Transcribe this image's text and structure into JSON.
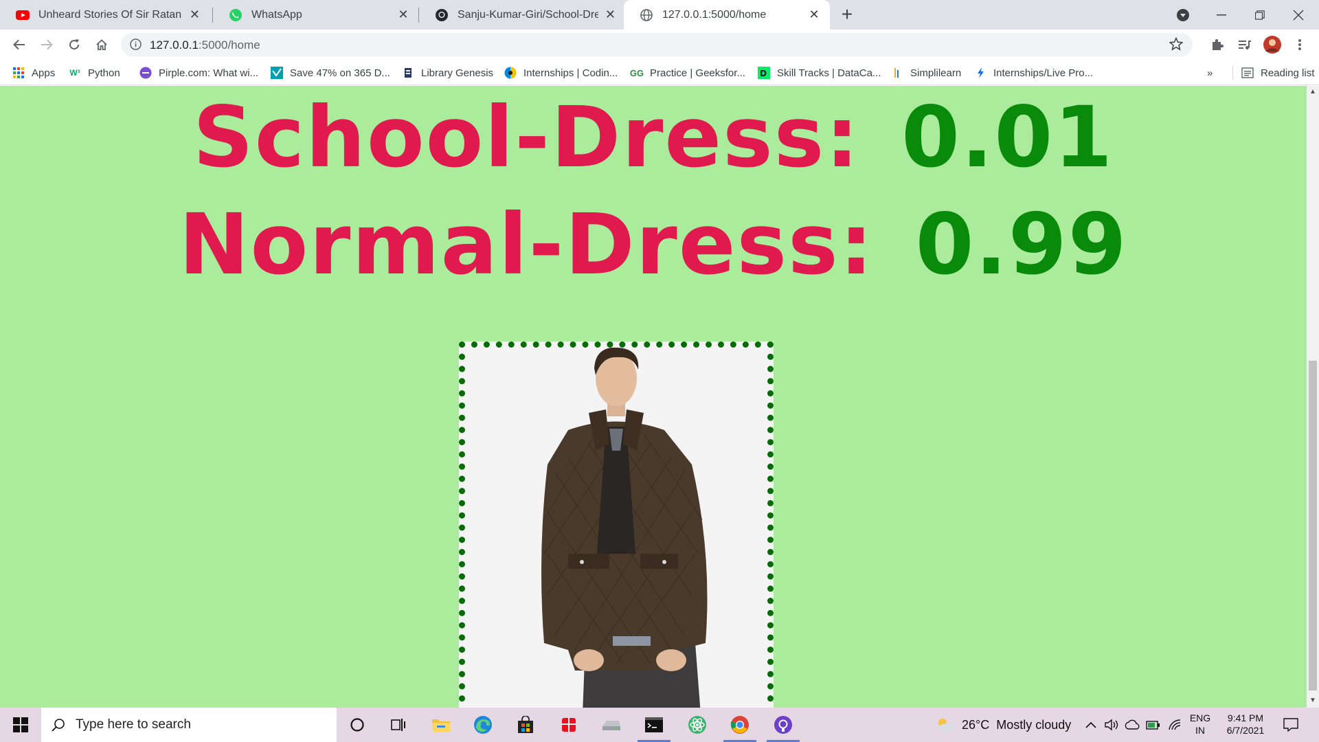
{
  "browser": {
    "tabs": [
      {
        "title": "Unheard Stories Of Sir Ratan Tata",
        "icon": "youtube-icon",
        "active": false
      },
      {
        "title": "WhatsApp",
        "icon": "whatsapp-icon",
        "active": false
      },
      {
        "title": "Sanju-Kumar-Giri/School-Dress-\\",
        "icon": "github-icon",
        "active": false
      },
      {
        "title": "127.0.0.1:5000/home",
        "icon": "globe-icon",
        "active": true
      }
    ],
    "address": {
      "host": "127.0.0.1",
      "path": ":5000/home"
    },
    "bookmarks": [
      {
        "label": "Apps",
        "icon": "apps-grid-icon"
      },
      {
        "label": "Python",
        "icon": "w3schools-icon"
      },
      {
        "label": "Pirple.com: What wi...",
        "icon": "pirple-icon"
      },
      {
        "label": "Save 47% on 365 D...",
        "icon": "datacamp-icon"
      },
      {
        "label": "Library Genesis",
        "icon": "library-genesis-icon"
      },
      {
        "label": "Internships | Codin...",
        "icon": "internshala-icon"
      },
      {
        "label": "Practice | Geeksfor...",
        "icon": "geeksforgeeks-icon"
      },
      {
        "label": "Skill Tracks | DataCa...",
        "icon": "datacamp-skill-icon"
      },
      {
        "label": "Simplilearn",
        "icon": "simplilearn-icon"
      },
      {
        "label": "Internships/Live Pro...",
        "icon": "internship-live-icon"
      }
    ],
    "bookmarks_overflow": "»",
    "reading_list": "Reading list"
  },
  "page": {
    "predictions": [
      {
        "label": "School-Dress:",
        "value": "0.01"
      },
      {
        "label": "Normal-Dress:",
        "value": "0.99"
      }
    ],
    "colors": {
      "background": "#aaeb9c",
      "label": "#e0194e",
      "value": "#0a8a0a",
      "frame": "#056b05"
    }
  },
  "taskbar": {
    "search_placeholder": "Type here to search",
    "weather": {
      "temp": "26°C",
      "condition": "Mostly cloudy"
    },
    "language": {
      "line1": "ENG",
      "line2": "IN"
    },
    "clock": {
      "time": "9:41 PM",
      "date": "6/7/2021"
    }
  }
}
